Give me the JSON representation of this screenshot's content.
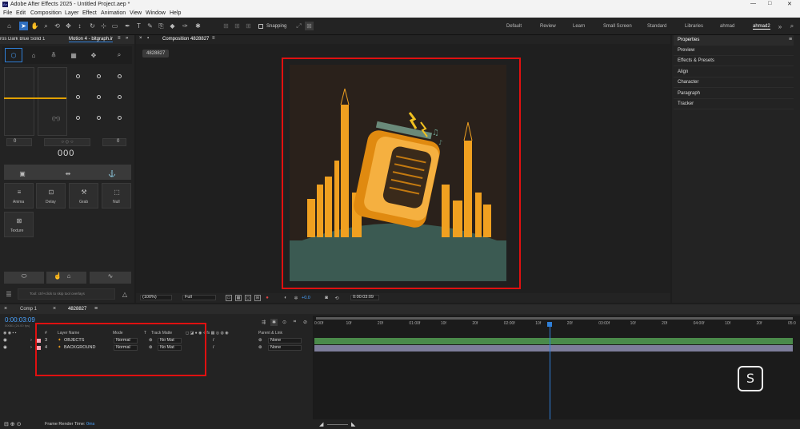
{
  "title_bar": {
    "app_title": "Adobe After Effects 2025 - Untitled Project.aep *",
    "controls": [
      "—",
      "□",
      "✕"
    ]
  },
  "menu": [
    "File",
    "Edit",
    "Composition",
    "Layer",
    "Effect",
    "Animation",
    "View",
    "Window",
    "Help"
  ],
  "toolbar": {
    "snapping_label": "Snapping",
    "workspaces": [
      "Default",
      "Review",
      "Learn",
      "Small Screen",
      "Standard",
      "Libraries",
      "ahmad",
      "ahmad2"
    ],
    "active_workspace": "ahmad2"
  },
  "left_panel": {
    "tab1": "ros Dark Blue Solid 1",
    "tab2": "Motion 4 - bitgraph.ir",
    "num_left": "0",
    "num_right": "0",
    "center_readout": "000",
    "tool_buttons": [
      {
        "label": "Anima"
      },
      {
        "label": "Delay"
      },
      {
        "label": "Grab"
      },
      {
        "label": "Null"
      }
    ],
    "texture_label": "Texture",
    "tip_text": "Tool: ctrl+click to skip tool overlays"
  },
  "composition": {
    "tab_label": "Composition 4828827",
    "subtab": "4828827",
    "zoom": "(100%)",
    "resolution": "Full",
    "exposure": "+0.0",
    "timecode": "0:00:03:09"
  },
  "right_panel": {
    "items": [
      "Properties",
      "Preview",
      "Effects & Presets",
      "Align",
      "Character",
      "Paragraph",
      "Tracker"
    ]
  },
  "timeline": {
    "tabs": [
      "Comp 1",
      "4828827"
    ],
    "timecode": "0:00:03:09",
    "timecode_sub": "00081 (24.00 fps)",
    "columns": {
      "num": "#",
      "layer_name": "Layer Name",
      "mode": "Mode",
      "t": "T",
      "track_matte": "Track Matte",
      "parent": "Parent & Link"
    },
    "layers": [
      {
        "num": "3",
        "name": "OBJECTS",
        "mode": "Normal",
        "matte": "No Mat",
        "parent": "None",
        "bar_color": "#4a8a4a"
      },
      {
        "num": "4",
        "name": "BACKGROUND",
        "mode": "Normal",
        "matte": "No Mat",
        "parent": "None",
        "bar_color": "#7d7d9a"
      }
    ],
    "ruler": [
      "0:00f",
      "10f",
      "20f",
      "01:00f",
      "10f",
      "20f",
      "02:00f",
      "10f",
      "20f",
      "03:00f",
      "10f",
      "20f",
      "04:00f",
      "10f",
      "20f",
      "05:0"
    ],
    "playhead_fraction": 0.49,
    "render_time_label": "Frame Render Time:",
    "render_time_value": "0ms"
  },
  "colors": {
    "highlight_red": "#e01010",
    "accent_blue": "#2f7fd8",
    "timecode_blue": "#4aa3ff",
    "art_orange": "#f0a020",
    "art_dark": "#2a211b",
    "art_ground": "#3b5a52"
  }
}
